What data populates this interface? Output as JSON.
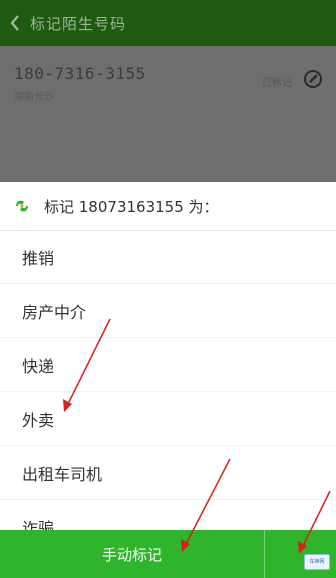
{
  "header": {
    "title": "标记陌生号码"
  },
  "caller": {
    "number": "180-7316-3155",
    "sub": "湖南长沙",
    "right_label": "已标记"
  },
  "sheet": {
    "title": "标记 18073163155 为：",
    "options": [
      "推销",
      "房产中介",
      "快递",
      "外卖",
      "出租车司机",
      "诈骗"
    ]
  },
  "footer": {
    "manual_label": "手动标记"
  },
  "watermark": {
    "text": "车神网"
  },
  "colors": {
    "accent": "#2fb52b",
    "titlebar": "#1f5a10",
    "arrow": "#d8201c"
  },
  "icons": [
    "back-arrow-icon",
    "edit-icon",
    "brand-logo-icon",
    "watermark-logo-icon"
  ]
}
